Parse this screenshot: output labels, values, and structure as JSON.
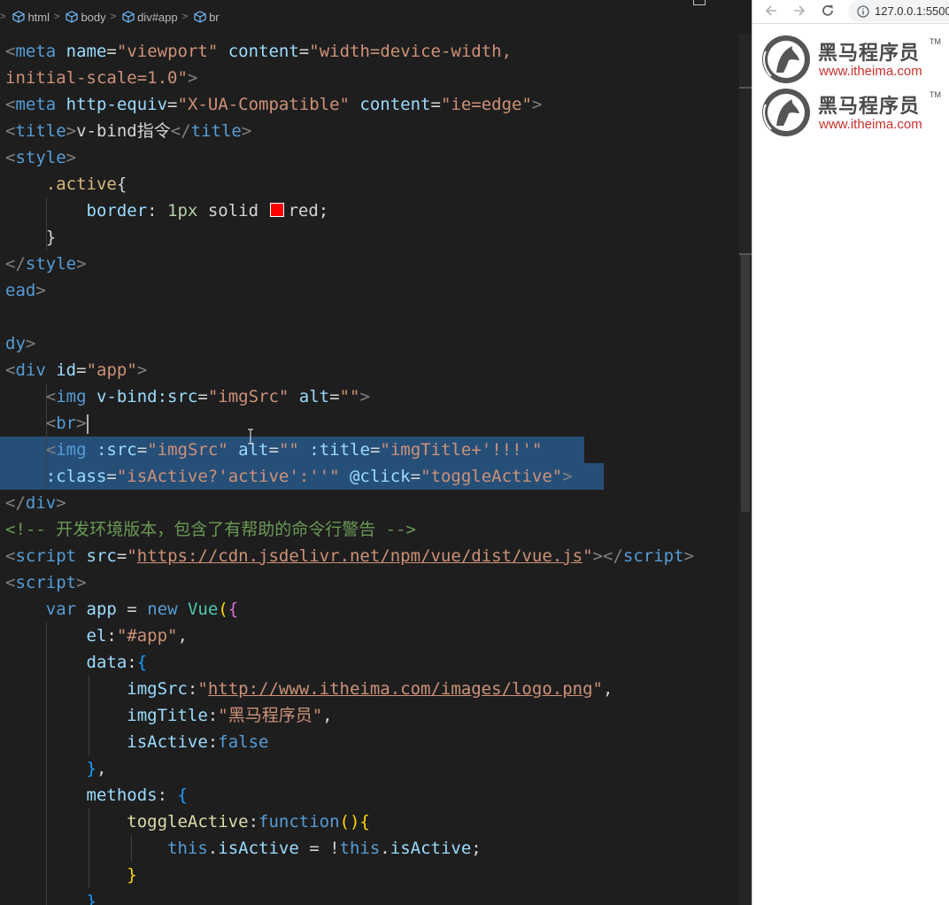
{
  "breadcrumb": [
    "html",
    "body",
    "div#app",
    "br"
  ],
  "code_lines": [
    [
      [
        "t-punc",
        "<"
      ],
      [
        "t-tag",
        "meta "
      ],
      [
        "t-attr",
        "name"
      ],
      [
        "t-text",
        "="
      ],
      [
        "t-str",
        "\"viewport\""
      ],
      [
        "t-text",
        " "
      ],
      [
        "t-attr",
        "content"
      ],
      [
        "t-text",
        "="
      ],
      [
        "t-str",
        "\"width=device-width,"
      ]
    ],
    [
      [
        "t-str",
        "initial-scale=1.0\""
      ],
      [
        "t-punc",
        ">"
      ]
    ],
    [
      [
        "t-punc",
        "<"
      ],
      [
        "t-tag",
        "meta "
      ],
      [
        "t-attr",
        "http-equiv"
      ],
      [
        "t-text",
        "="
      ],
      [
        "t-str",
        "\"X-UA-Compatible\""
      ],
      [
        "t-text",
        " "
      ],
      [
        "t-attr",
        "content"
      ],
      [
        "t-text",
        "="
      ],
      [
        "t-str",
        "\"ie=edge\""
      ],
      [
        "t-punc",
        ">"
      ]
    ],
    [
      [
        "t-punc",
        "<"
      ],
      [
        "t-tag",
        "title"
      ],
      [
        "t-punc",
        ">"
      ],
      [
        "t-text",
        "v-bind指令"
      ],
      [
        "t-punc",
        "</"
      ],
      [
        "t-tag",
        "title"
      ],
      [
        "t-punc",
        ">"
      ]
    ],
    [
      [
        "t-punc",
        "<"
      ],
      [
        "t-tag",
        "style"
      ],
      [
        "t-punc",
        ">"
      ]
    ],
    [
      [
        "t-text",
        "    "
      ],
      [
        "t-cls",
        ".active"
      ],
      [
        "t-text",
        "{"
      ]
    ],
    [
      [
        "t-text",
        "        "
      ],
      [
        "t-prop",
        "border"
      ],
      [
        "t-text",
        ": "
      ],
      [
        "t-num",
        "1px"
      ],
      [
        "t-text",
        " solid "
      ],
      [
        "swatch",
        ""
      ],
      [
        "t-text",
        "red;"
      ]
    ],
    [
      [
        "t-text",
        "    }"
      ]
    ],
    [
      [
        "t-punc",
        "</"
      ],
      [
        "t-tag",
        "style"
      ],
      [
        "t-punc",
        ">"
      ]
    ],
    [
      [
        "t-tag",
        "ead"
      ],
      [
        "t-punc",
        ">"
      ]
    ],
    [
      [
        "t-text",
        ""
      ]
    ],
    [
      [
        "t-tag",
        "dy"
      ],
      [
        "t-punc",
        ">"
      ]
    ],
    [
      [
        "t-punc",
        "<"
      ],
      [
        "t-tag",
        "div "
      ],
      [
        "t-attr",
        "id"
      ],
      [
        "t-text",
        "="
      ],
      [
        "t-str",
        "\"app\""
      ],
      [
        "t-punc",
        ">"
      ]
    ],
    [
      [
        "t-text",
        "    "
      ],
      [
        "t-punc",
        "<"
      ],
      [
        "t-tag",
        "img "
      ],
      [
        "t-attr",
        "v-bind:src"
      ],
      [
        "t-text",
        "="
      ],
      [
        "t-str",
        "\"imgSrc\""
      ],
      [
        "t-text",
        " "
      ],
      [
        "t-attr",
        "alt"
      ],
      [
        "t-text",
        "="
      ],
      [
        "t-str",
        "\"\""
      ],
      [
        "t-punc",
        ">"
      ]
    ],
    [
      [
        "t-text",
        "    "
      ],
      [
        "t-punc",
        "<"
      ],
      [
        "t-tag",
        "br"
      ],
      [
        "t-punc",
        ">"
      ],
      [
        "cursor",
        ""
      ]
    ],
    [
      [
        "t-text",
        "    "
      ],
      [
        "t-punc",
        "<"
      ],
      [
        "t-tag",
        "img "
      ],
      [
        "t-attr",
        ":src"
      ],
      [
        "t-text",
        "="
      ],
      [
        "t-str",
        "\"imgSrc\""
      ],
      [
        "t-text",
        " "
      ],
      [
        "t-attr",
        "alt"
      ],
      [
        "t-text",
        "="
      ],
      [
        "t-str",
        "\"\""
      ],
      [
        "t-text",
        " "
      ],
      [
        "t-attr",
        ":title"
      ],
      [
        "t-text",
        "="
      ],
      [
        "t-str",
        "\"imgTitle+'!!!'\""
      ]
    ],
    [
      [
        "t-text",
        "    "
      ],
      [
        "t-attr",
        ":class"
      ],
      [
        "t-text",
        "="
      ],
      [
        "t-str",
        "\"isActive?'active':''\""
      ],
      [
        "t-text",
        " "
      ],
      [
        "t-attr",
        "@click"
      ],
      [
        "t-text",
        "="
      ],
      [
        "t-str",
        "\"toggleActive\""
      ],
      [
        "t-punc",
        ">"
      ]
    ],
    [
      [
        "t-punc",
        "</"
      ],
      [
        "t-tag",
        "div"
      ],
      [
        "t-punc",
        ">"
      ]
    ],
    [
      [
        "t-cmt",
        "<!-- 开发环境版本，包含了有帮助的命令行警告 -->"
      ]
    ],
    [
      [
        "t-punc",
        "<"
      ],
      [
        "t-tag",
        "script "
      ],
      [
        "t-attr",
        "src"
      ],
      [
        "t-text",
        "="
      ],
      [
        "t-str",
        "\""
      ],
      [
        "t-link",
        "https://cdn.jsdelivr.net/npm/vue/dist/vue.js"
      ],
      [
        "t-str",
        "\""
      ],
      [
        "t-punc",
        "></"
      ],
      [
        "t-tag",
        "script"
      ],
      [
        "t-punc",
        ">"
      ]
    ],
    [
      [
        "t-punc",
        "<"
      ],
      [
        "t-tag",
        "script"
      ],
      [
        "t-punc",
        ">"
      ]
    ],
    [
      [
        "t-text",
        "    "
      ],
      [
        "t-kw",
        "var "
      ],
      [
        "t-prop",
        "app"
      ],
      [
        "t-text",
        " = "
      ],
      [
        "t-kw",
        "new "
      ],
      [
        "t-type",
        "Vue"
      ],
      [
        "t-brace",
        "("
      ],
      [
        "t-brace2",
        "{"
      ]
    ],
    [
      [
        "t-text",
        "        "
      ],
      [
        "t-prop",
        "el"
      ],
      [
        "t-text",
        ":"
      ],
      [
        "t-str",
        "\"#app\""
      ],
      [
        "t-text",
        ","
      ]
    ],
    [
      [
        "t-text",
        "        "
      ],
      [
        "t-prop",
        "data"
      ],
      [
        "t-text",
        ":"
      ],
      [
        "t-brace3",
        "{"
      ]
    ],
    [
      [
        "t-text",
        "            "
      ],
      [
        "t-prop",
        "imgSrc"
      ],
      [
        "t-text",
        ":"
      ],
      [
        "t-str",
        "\""
      ],
      [
        "t-link",
        "http://www.itheima.com/images/logo.png"
      ],
      [
        "t-str",
        "\""
      ],
      [
        "t-text",
        ","
      ]
    ],
    [
      [
        "t-text",
        "            "
      ],
      [
        "t-prop",
        "imgTitle"
      ],
      [
        "t-text",
        ":"
      ],
      [
        "t-str",
        "\"黑马程序员\""
      ],
      [
        "t-text",
        ","
      ]
    ],
    [
      [
        "t-text",
        "            "
      ],
      [
        "t-prop",
        "isActive"
      ],
      [
        "t-text",
        ":"
      ],
      [
        "t-kw",
        "false"
      ]
    ],
    [
      [
        "t-text",
        "        "
      ],
      [
        "t-brace3",
        "}"
      ],
      [
        "t-text",
        ","
      ]
    ],
    [
      [
        "t-text",
        "        "
      ],
      [
        "t-prop",
        "methods"
      ],
      [
        "t-text",
        ": "
      ],
      [
        "t-brace3",
        "{"
      ]
    ],
    [
      [
        "t-text",
        "            "
      ],
      [
        "t-fn",
        "toggleActive"
      ],
      [
        "t-text",
        ":"
      ],
      [
        "t-kw",
        "function"
      ],
      [
        "t-brace",
        "()"
      ],
      [
        "t-brace",
        "{"
      ]
    ],
    [
      [
        "t-text",
        "                "
      ],
      [
        "t-kw",
        "this"
      ],
      [
        "t-text",
        "."
      ],
      [
        "t-prop",
        "isActive"
      ],
      [
        "t-text",
        " = !"
      ],
      [
        "t-kw",
        "this"
      ],
      [
        "t-text",
        "."
      ],
      [
        "t-prop",
        "isActive"
      ],
      [
        "t-text",
        ";"
      ]
    ],
    [
      [
        "t-text",
        "            "
      ],
      [
        "t-brace",
        "}"
      ]
    ],
    [
      [
        "t-text",
        "        "
      ],
      [
        "t-brace3",
        "}"
      ]
    ]
  ],
  "browser": {
    "url": "127.0.0.1:5500",
    "logo_text": "黑马程序员",
    "logo_tm": "TM",
    "logo_url": "www.itheima.com"
  },
  "colors": {
    "editor_bg": "#1e1e1e",
    "selection": "#264f78",
    "logo_red": "#c9302c"
  }
}
